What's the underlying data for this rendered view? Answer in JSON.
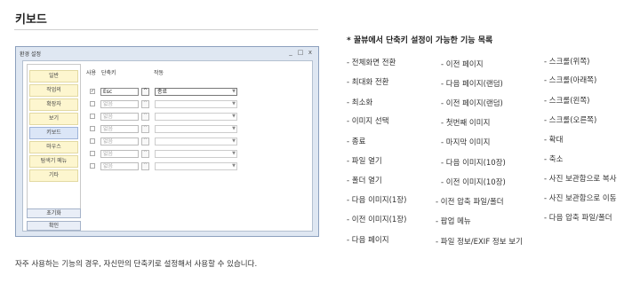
{
  "section_title": "키보드",
  "dialog": {
    "title": "환경 설정",
    "controls": [
      "_",
      "□",
      "x"
    ],
    "nav_items": [
      "일반",
      "작업의",
      "확장자",
      "보기",
      "키보드",
      "마우스",
      "탐색기 메뉴",
      "기타"
    ],
    "selected_nav": "키보드",
    "headers": {
      "use": "사용",
      "key": "단축키",
      "action": "작동"
    },
    "rows": [
      {
        "checked": true,
        "key": "Esc",
        "cap": "^",
        "action": "종료"
      },
      {
        "checked": false,
        "key": "없음",
        "cap": "^",
        "action": ""
      },
      {
        "checked": false,
        "key": "없음",
        "cap": "^",
        "action": ""
      },
      {
        "checked": false,
        "key": "없음",
        "cap": "^",
        "action": ""
      },
      {
        "checked": false,
        "key": "없음",
        "cap": "^",
        "action": ""
      },
      {
        "checked": false,
        "key": "없음",
        "cap": "^",
        "action": ""
      },
      {
        "checked": false,
        "key": "없음",
        "cap": "^",
        "action": ""
      }
    ],
    "reset_button": "초기화",
    "ok_button": "확인"
  },
  "feature_list": {
    "title": "* 꿀뷰에서 단축키 설정이 가능한 기능 목록",
    "col1": [
      "- 전체화면 전환",
      "- 최대화 전환",
      "- 최소화",
      "- 이미지 선택",
      "- 종료",
      "- 파일 열기",
      "- 폴더 열기",
      "- 다음 이미지(1장)",
      "- 이전 이미지(1장)",
      "- 다음 페이지"
    ],
    "col2": [
      "- 이전 페이지",
      "- 다음 페이지(랜덤)",
      "- 이전 페이지(랜덤)",
      "- 첫번째 이미지",
      "- 마지막 이미지",
      "- 다음 이미지(10장)",
      "- 이전 이미지(10장)",
      "- 이전 압축 파일/폴더",
      "- 팝업 메뉴",
      "- 파일 정보/EXIF 정보 보기"
    ],
    "col3": [
      "- 스크롤(위쪽)",
      "- 스크롤(아래쪽)",
      "- 스크롤(왼쪽)",
      "- 스크롤(오른쪽)",
      "- 확대",
      "- 축소",
      "- 사진 보관함으로 복사",
      "- 사진 보관함으로 이동",
      "- 다음 압축 파일/폴더"
    ]
  },
  "caption": "자주 사용하는 기능의 경우, 자신만의 단축키로 설정해서 사용할 수 있습니다."
}
